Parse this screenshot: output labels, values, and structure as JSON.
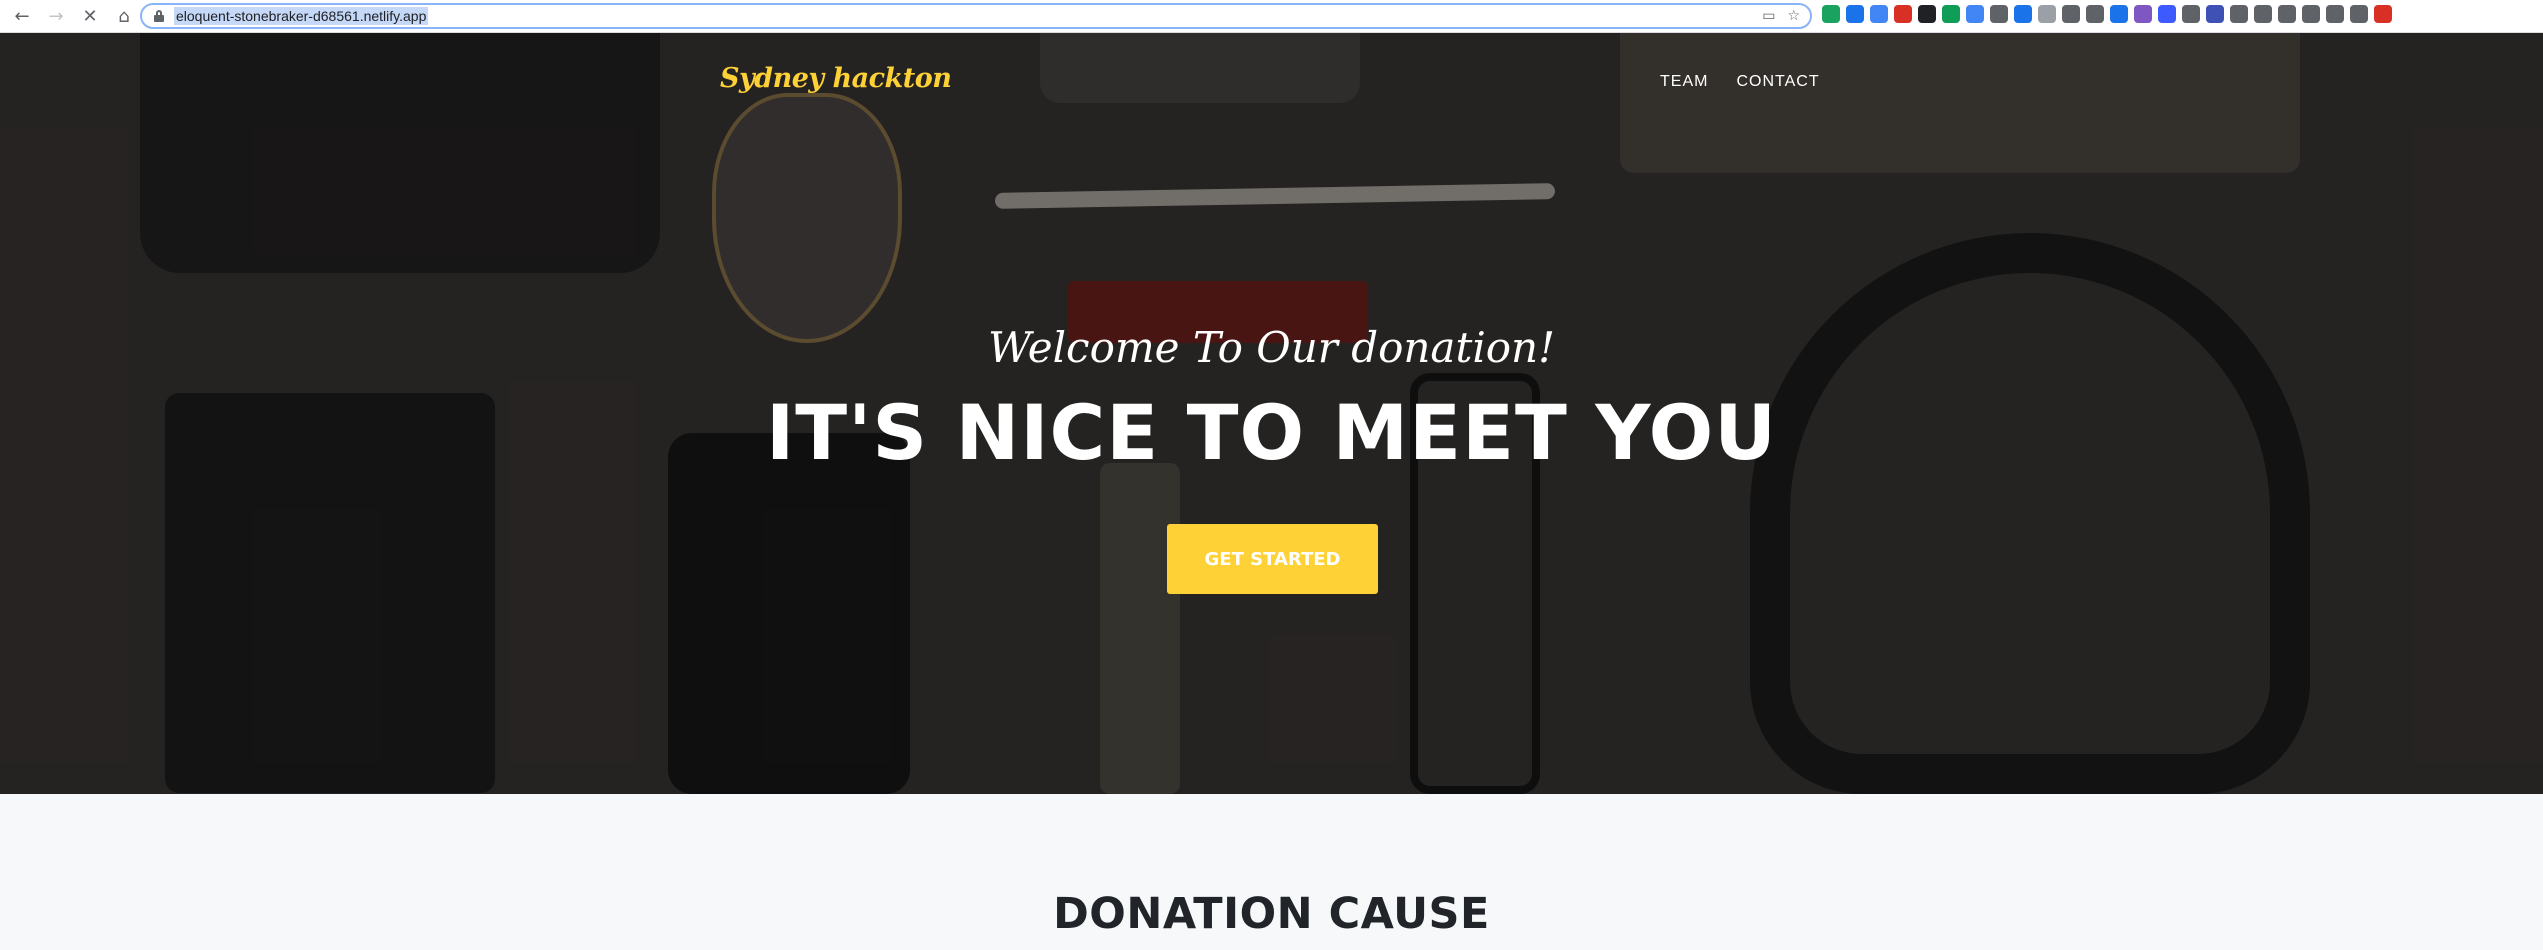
{
  "browser": {
    "url": "eloquent-stonebraker-d68561.netlify.app",
    "back_icon": "arrow-left-icon",
    "forward_icon": "arrow-right-icon",
    "reload_icon": "stop-loading-icon",
    "home_icon": "home-icon",
    "extension_colors": [
      "#1aa260",
      "#1a73e8",
      "#4285f4",
      "#d93025",
      "#202124",
      "#0f9d58",
      "#4285f4",
      "#5f6368",
      "#1a73e8",
      "#9aa0a6",
      "#5f6368",
      "#5f6368",
      "#1a73e8",
      "#7e57c2",
      "#3d5afe",
      "#5f6368",
      "#3f51b5",
      "#5f6368",
      "#5f6368",
      "#5f6368",
      "#5f6368",
      "#5f6368",
      "#5f6368",
      "#d93025"
    ]
  },
  "site": {
    "brand": "Sydney hackton",
    "nav": [
      "TEAM",
      "CONTACT"
    ],
    "hero": {
      "lead_in": "Welcome To Our donation!",
      "heading": "IT'S NICE TO MEET YOU",
      "cta_label": "GET STARTED"
    },
    "section_title": "DONATION CAUSE"
  },
  "colors": {
    "accent": "#fed136",
    "hero_bg": "#2e2b29",
    "section_bg": "#f7f8fa",
    "heading_dark": "#212529"
  }
}
